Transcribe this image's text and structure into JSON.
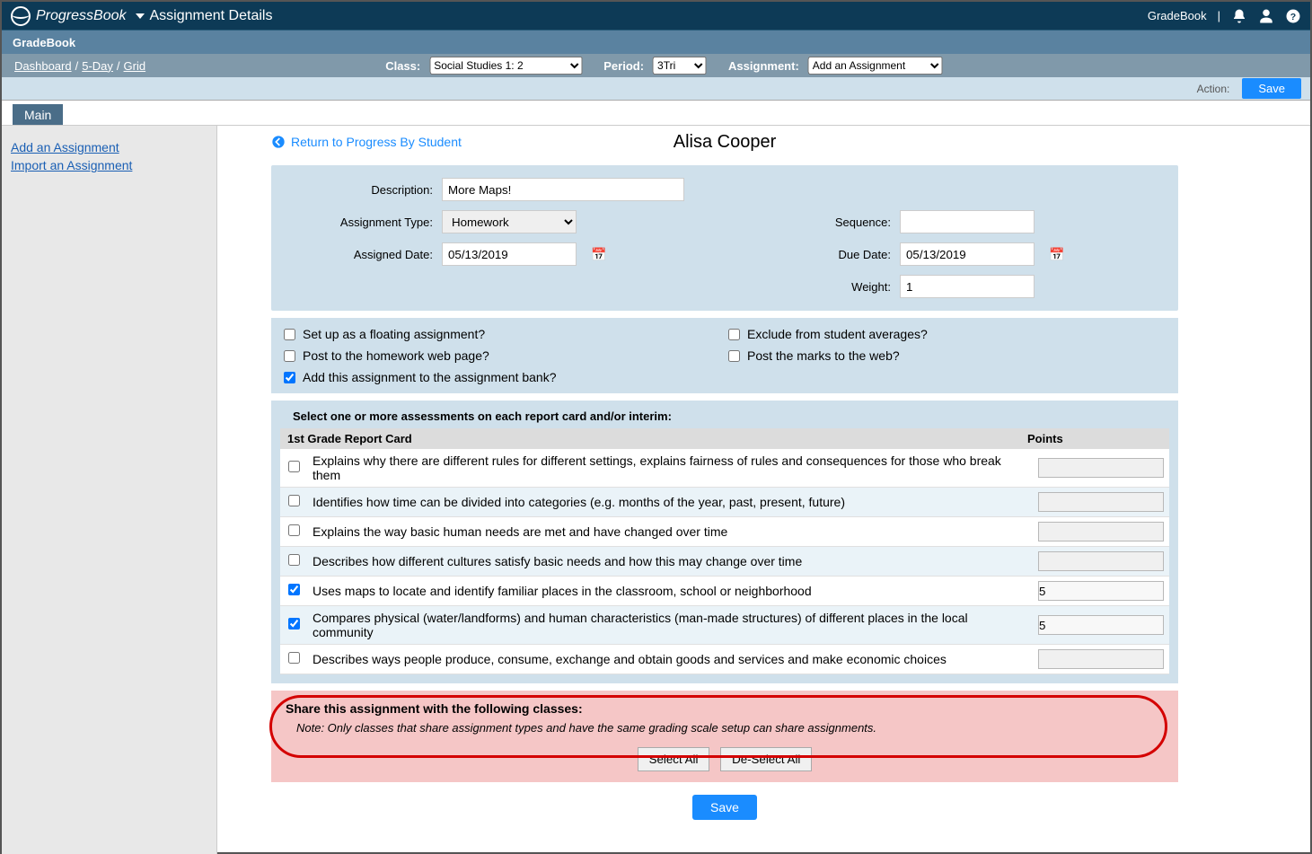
{
  "header": {
    "logo_text": "ProgressBook",
    "page_title": "Assignment Details",
    "gradebook_link": "GradeBook",
    "pipe": "|"
  },
  "subheader": {
    "label": "GradeBook"
  },
  "breadcrumbs": {
    "dashboard": "Dashboard",
    "fiveday": "5-Day",
    "grid": "Grid",
    "class_label": "Class:",
    "class_value": "Social Studies 1: 2",
    "period_label": "Period:",
    "period_value": "3Tri",
    "assignment_label": "Assignment:",
    "assignment_value": "Add an Assignment"
  },
  "actionbar": {
    "action_label": "Action:",
    "save": "Save"
  },
  "tab": {
    "main": "Main"
  },
  "sidebar": {
    "add": "Add an Assignment",
    "import": "Import an Assignment"
  },
  "content": {
    "return_link": "Return to Progress By Student",
    "student_name": "Alisa Cooper",
    "labels": {
      "description": "Description:",
      "atype": "Assignment Type:",
      "adate": "Assigned Date:",
      "sequence": "Sequence:",
      "ddate": "Due Date:",
      "weight": "Weight:"
    },
    "values": {
      "description": "More Maps!",
      "atype": "Homework",
      "adate": "05/13/2019",
      "sequence": "",
      "ddate": "05/13/2019",
      "weight": "1"
    },
    "options": {
      "floating": "Set up as a floating assignment?",
      "exclude": "Exclude from student averages?",
      "post_hw": "Post to the homework web page?",
      "post_marks": "Post the marks to the web?",
      "add_bank": "Add this assignment to the assignment bank?"
    },
    "assess": {
      "select_label": "Select one or more assessments on each report card and/or interim:",
      "card_title": "1st Grade Report Card",
      "points_label": "Points",
      "rows": [
        {
          "text": "Explains why there are different rules for different settings, explains fairness of rules and consequences for those who break them",
          "checked": false,
          "points": ""
        },
        {
          "text": "Identifies how time can be divided into categories (e.g. months of the year, past, present, future)",
          "checked": false,
          "points": ""
        },
        {
          "text": "Explains the way basic human needs are met and have changed over time",
          "checked": false,
          "points": ""
        },
        {
          "text": "Describes how different cultures satisfy basic needs and how this may change over time",
          "checked": false,
          "points": ""
        },
        {
          "text": "Uses maps to locate and identify familiar places in the classroom, school or neighborhood",
          "checked": true,
          "points": "5"
        },
        {
          "text": "Compares physical (water/landforms) and human characteristics (man-made structures) of different places in the local community",
          "checked": true,
          "points": "5"
        },
        {
          "text": "Describes ways people produce, consume, exchange and obtain goods and services and make economic choices",
          "checked": false,
          "points": ""
        }
      ]
    },
    "share": {
      "title": "Share this assignment with the following classes:",
      "note": "Note: Only classes that share assignment types and have the same grading scale setup can share assignments.",
      "select_all": "Select All",
      "deselect_all": "De-Select All"
    },
    "bottom_save": "Save"
  }
}
